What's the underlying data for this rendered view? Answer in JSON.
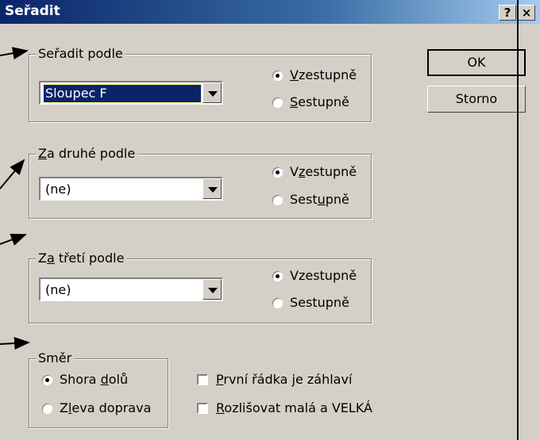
{
  "window": {
    "title": "Seřadit",
    "help_button": "?",
    "close_button": "×"
  },
  "buttons": {
    "ok": "OK",
    "cancel": "Storno"
  },
  "sort_by": {
    "legend": "Seřadit podle",
    "combo_value": "Sloupec F",
    "ascending": {
      "pre": "",
      "acc": "V",
      "post": "zestupně",
      "checked": true
    },
    "descending": {
      "pre": "",
      "acc": "S",
      "post": "estupně",
      "checked": false
    }
  },
  "then_by": {
    "legend": {
      "pre": "",
      "acc": "Z",
      "post": "a druhé podle"
    },
    "combo_value": "(ne)",
    "ascending": {
      "pre": "V",
      "acc": "z",
      "post": "estupně",
      "checked": true
    },
    "descending": {
      "pre": "Sest",
      "acc": "u",
      "post": "pně",
      "checked": false
    }
  },
  "then_by2": {
    "legend": {
      "pre": "Z",
      "acc": "a",
      "post": " třetí podle"
    },
    "combo_value": "(ne)",
    "ascending": {
      "label": "Vzestupně",
      "checked": true
    },
    "descending": {
      "label": "Sestupně",
      "checked": false
    }
  },
  "direction": {
    "legend": "Směr",
    "top_to_bottom": {
      "pre": "Shora ",
      "acc": "d",
      "post": "olů",
      "checked": true
    },
    "left_to_right": {
      "pre": "Z",
      "acc": "l",
      "post": "eva doprava",
      "checked": false
    }
  },
  "options": {
    "header_row": {
      "pre": "",
      "acc": "P",
      "post": "rvní řádka je záhlaví",
      "checked": false
    },
    "case_sensitive": {
      "pre": "",
      "acc": "R",
      "post": "ozlišovat malá a VELKÁ",
      "checked": false
    }
  }
}
